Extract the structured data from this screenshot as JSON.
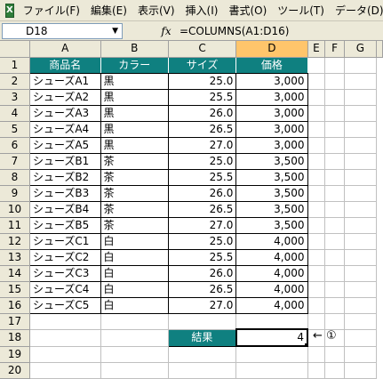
{
  "menu": {
    "items": [
      "ファイル(F)",
      "編集(E)",
      "表示(V)",
      "挿入(I)",
      "書式(O)",
      "ツール(T)",
      "データ(D)"
    ]
  },
  "formula_bar": {
    "name_box": "D18",
    "fx_label": "fx",
    "formula": "=COLUMNS(A1:D16)"
  },
  "grid": {
    "columns": [
      "A",
      "B",
      "C",
      "D",
      "E",
      "F",
      "G"
    ],
    "header_row": [
      "商品名",
      "カラー",
      "サイズ",
      "価格"
    ],
    "rows": [
      [
        "シューズA1",
        "黒",
        "25.0",
        "3,000"
      ],
      [
        "シューズA2",
        "黒",
        "25.5",
        "3,000"
      ],
      [
        "シューズA3",
        "黒",
        "26.0",
        "3,000"
      ],
      [
        "シューズA4",
        "黒",
        "26.5",
        "3,000"
      ],
      [
        "シューズA5",
        "黒",
        "27.0",
        "3,000"
      ],
      [
        "シューズB1",
        "茶",
        "25.0",
        "3,500"
      ],
      [
        "シューズB2",
        "茶",
        "25.5",
        "3,500"
      ],
      [
        "シューズB3",
        "茶",
        "26.0",
        "3,500"
      ],
      [
        "シューズB4",
        "茶",
        "26.5",
        "3,500"
      ],
      [
        "シューズB5",
        "茶",
        "27.0",
        "3,500"
      ],
      [
        "シューズC1",
        "白",
        "25.0",
        "4,000"
      ],
      [
        "シューズC2",
        "白",
        "25.5",
        "4,000"
      ],
      [
        "シューズC3",
        "白",
        "26.0",
        "4,000"
      ],
      [
        "シューズC4",
        "白",
        "26.5",
        "4,000"
      ],
      [
        "シューズC5",
        "白",
        "27.0",
        "4,000"
      ]
    ],
    "row_numbers": [
      "1",
      "2",
      "3",
      "4",
      "5",
      "6",
      "7",
      "8",
      "9",
      "10",
      "11",
      "12",
      "13",
      "14",
      "15",
      "16",
      "17",
      "18",
      "19",
      "20"
    ],
    "result_label": "結果",
    "result_value": "4",
    "annotation": "← ①"
  },
  "colors": {
    "header_fill": "#0f8080",
    "active_column_header": "#ffc56b"
  }
}
